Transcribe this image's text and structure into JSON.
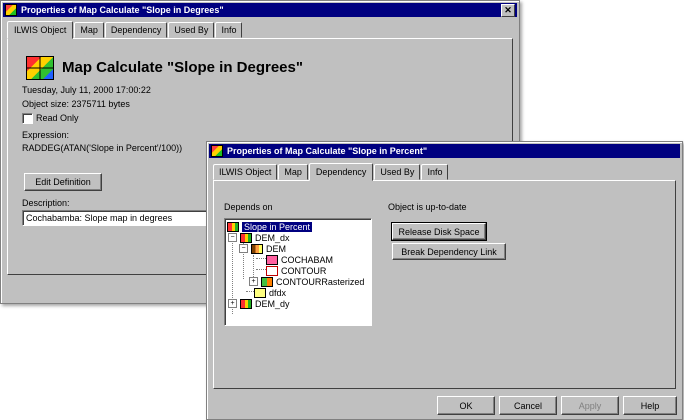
{
  "back_window": {
    "title": "Properties of Map Calculate \"Slope in Degrees\"",
    "tabs": [
      "ILWIS Object",
      "Map",
      "Dependency",
      "Used By",
      "Info"
    ],
    "heading": "Map Calculate \"Slope in Degrees\"",
    "date": "Tuesday, July 11, 2000 17:00:22",
    "size": "Object size: 2375711 bytes",
    "read_only": "Read Only",
    "expression_label": "Expression:",
    "expression": "RADDEG(ATAN('Slope in Percent'/100))",
    "edit_button": "Edit Definition",
    "description_label": "Description:",
    "description": "Cochabamba: Slope map in degrees"
  },
  "front_window": {
    "title": "Properties of Map Calculate \"Slope in Percent\"",
    "tabs": [
      "ILWIS Object",
      "Map",
      "Dependency",
      "Used By",
      "Info"
    ],
    "depends_label": "Depends on",
    "status": "Object is up-to-date",
    "release_button": "Release Disk Space",
    "break_button": "Break Dependency Link",
    "tree": {
      "root": "Slope in Percent",
      "dem_dx": "DEM_dx",
      "dem": "DEM",
      "cochabam": "COCHABAM",
      "contour": "CONTOUR",
      "contour_rasterized": "CONTOURRasterized",
      "dfdx": "dfdx",
      "dem_dy": "DEM_dy"
    },
    "footer": {
      "ok": "OK",
      "cancel": "Cancel",
      "apply": "Apply",
      "help": "Help"
    }
  }
}
